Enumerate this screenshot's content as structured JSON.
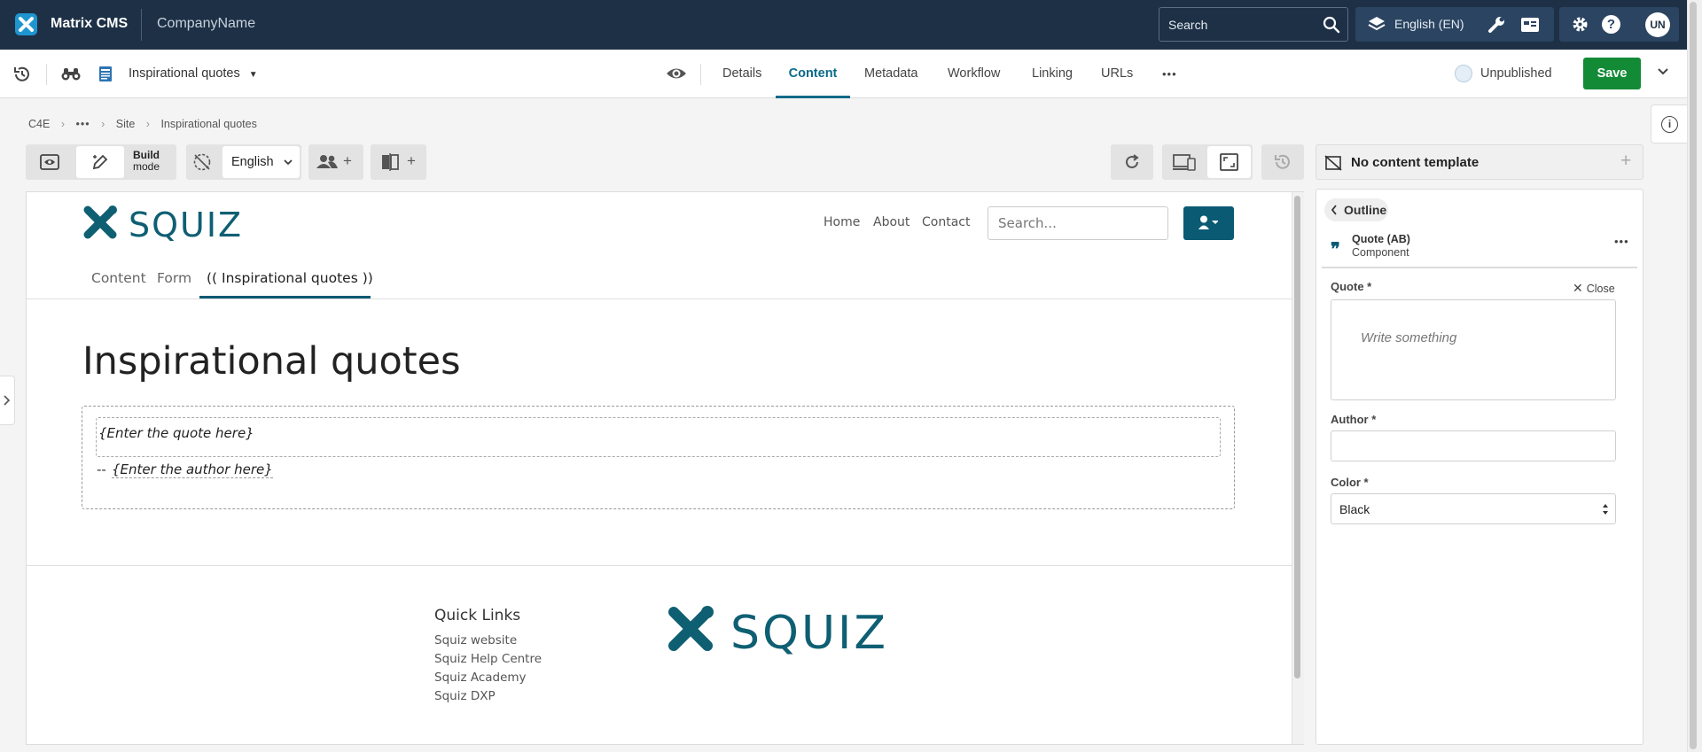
{
  "app": {
    "name": "Matrix CMS",
    "company": "CompanyName",
    "search_placeholder": "Search",
    "language": "English (EN)",
    "user_initials": "UN"
  },
  "toolbar": {
    "asset_name": "Inspirational quotes",
    "tabs": [
      "Details",
      "Content",
      "Metadata",
      "Workflow",
      "Linking",
      "URLs"
    ],
    "active_tab": "Content",
    "more": "•••",
    "status": "Unpublished",
    "save_label": "Save"
  },
  "breadcrumb": [
    "C4E",
    "•••",
    "Site",
    "Inspirational quotes"
  ],
  "editor_tools": {
    "build_mode_line1": "Build",
    "build_mode_line2": "mode",
    "language_select": "English",
    "plus": "+"
  },
  "preview": {
    "logo_text": "SQUIZ",
    "nav": [
      "Home",
      "About",
      "Contact"
    ],
    "search_placeholder": "Search...",
    "subtabs": [
      "Content",
      "Form",
      "(( Inspirational quotes ))"
    ],
    "page_heading": "Inspirational quotes",
    "quote_placeholder": "{Enter the quote here}",
    "author_prefix": "--",
    "author_placeholder": "{Enter the author here}",
    "footer_heading": "Quick Links",
    "footer_links": [
      "Squiz website",
      "Squiz Help Centre",
      "Squiz Academy",
      "Squiz DXP"
    ]
  },
  "panel": {
    "template_label": "No content template",
    "outline_label": "Outline",
    "component_name": "Quote (AB)",
    "component_type": "Component",
    "quote_label": "Quote *",
    "close_label": "Close",
    "quote_placeholder": "Write something",
    "author_label": "Author *",
    "author_value": "",
    "color_label": "Color *",
    "color_value": "Black"
  },
  "colors": {
    "topbar": "#1d3046",
    "accent": "#0a6a88",
    "save_green": "#138a36",
    "squiz_teal": "#0f5f73"
  }
}
